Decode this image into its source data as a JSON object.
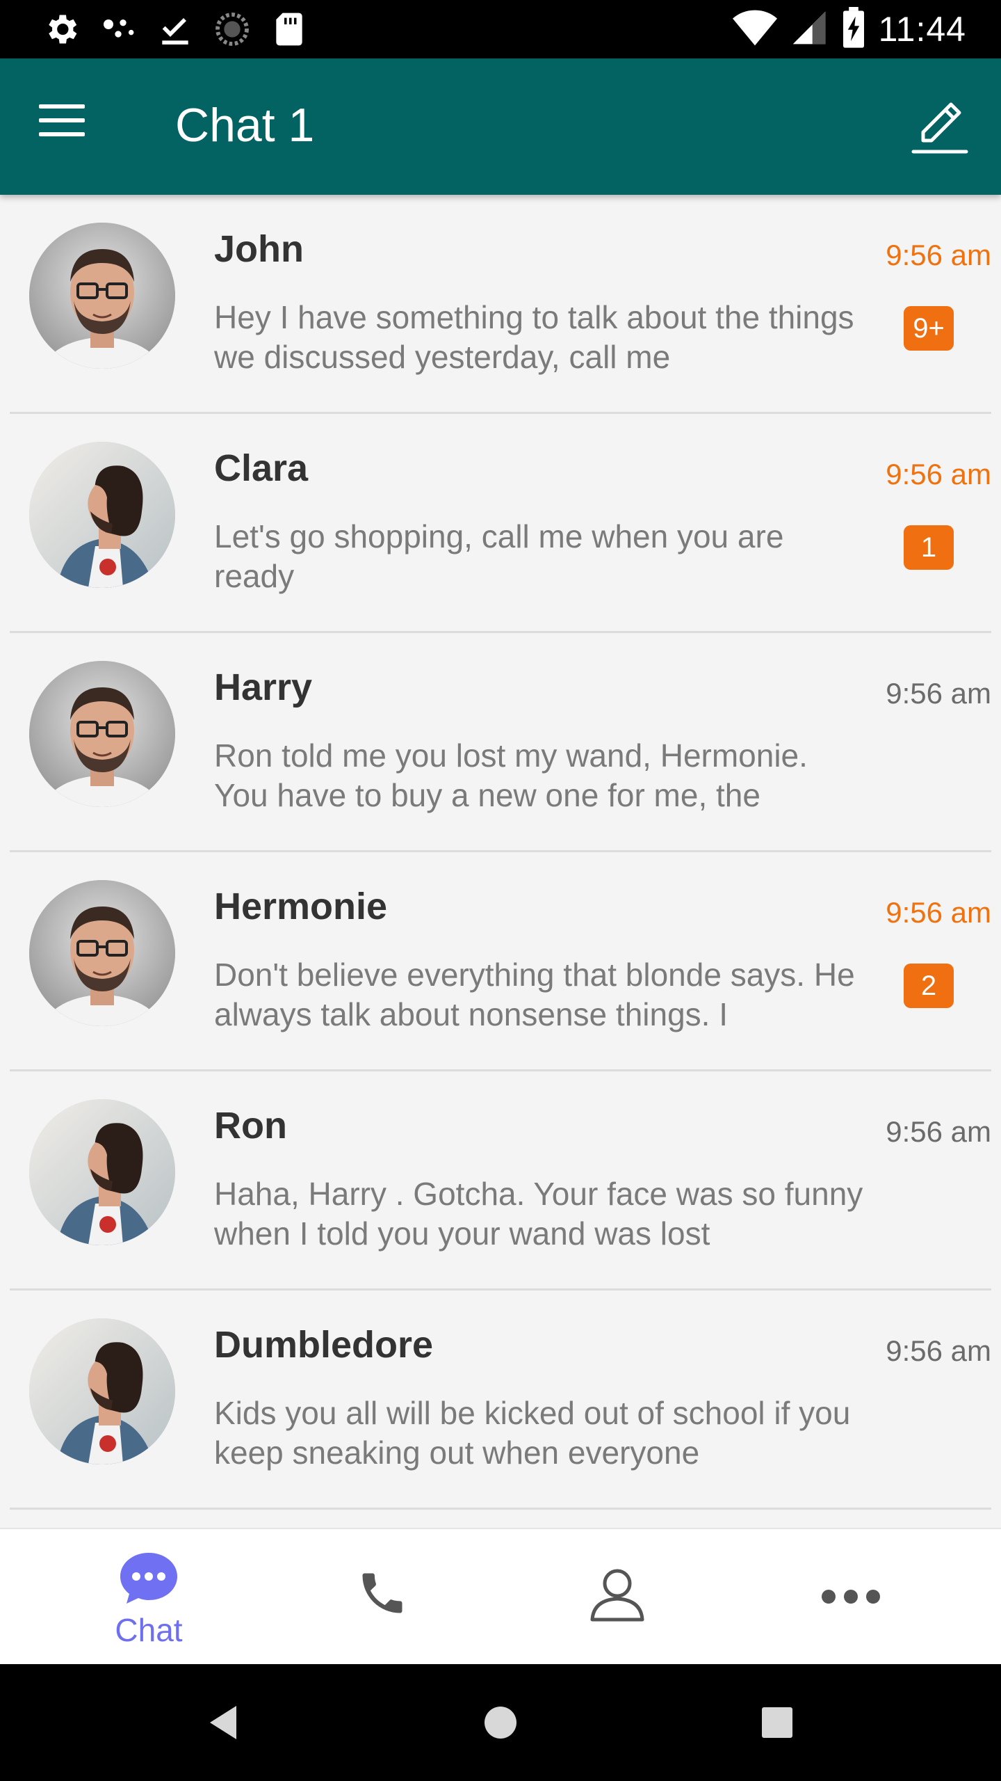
{
  "status_bar": {
    "time": "11:44",
    "left_icons": [
      "settings-icon",
      "dots-icon",
      "download-done-icon",
      "sync-icon",
      "sd-card-icon"
    ],
    "right_icons": [
      "wifi-icon",
      "signal-icon",
      "battery-charging-icon"
    ]
  },
  "app_bar": {
    "title": "Chat 1",
    "menu_icon": "hamburger-menu-icon",
    "action_icon": "edit-pencil-icon",
    "background": "#036262"
  },
  "colors": {
    "unread_time": "#f0720f",
    "badge": "#f06f10",
    "read_time": "#6b6b6b",
    "active_nav": "#6e6ef0"
  },
  "chats": [
    {
      "name": "John",
      "message": "Hey I have something to talk about the things we discussed yesterday, call me",
      "time": "9:56 am",
      "badge": "9+",
      "unread": true,
      "avatar": "glasses-man"
    },
    {
      "name": "Clara",
      "message": "Let's go shopping, call me when you are ready",
      "time": "9:56 am",
      "badge": "1",
      "unread": true,
      "avatar": "profile-man"
    },
    {
      "name": "Harry",
      "message": "Ron told me you lost my wand, Hermonie. You have to buy a new one for me, the",
      "time": "9:56 am",
      "badge": "",
      "unread": false,
      "avatar": "glasses-man"
    },
    {
      "name": "Hermonie",
      "message": "Don't believe everything that blonde says. He always talk about nonsense things. I",
      "time": "9:56 am",
      "badge": "2",
      "unread": true,
      "avatar": "glasses-man"
    },
    {
      "name": "Ron",
      "message": "Haha, Harry . Gotcha. Your face was so funny when I told you your wand was lost",
      "time": "9:56 am",
      "badge": "",
      "unread": false,
      "avatar": "profile-man"
    },
    {
      "name": "Dumbledore",
      "message": "Kids you all will be kicked out of school if you keep sneaking out when everyone",
      "time": "9:56 am",
      "badge": "",
      "unread": false,
      "avatar": "profile-man"
    }
  ],
  "bottom_nav": {
    "items": [
      {
        "label": "Chat",
        "icon": "chat-bubble-icon",
        "active": true
      },
      {
        "label": "",
        "icon": "phone-icon",
        "active": false
      },
      {
        "label": "",
        "icon": "person-icon",
        "active": false
      },
      {
        "label": "",
        "icon": "more-horizontal-icon",
        "active": false
      }
    ]
  },
  "system_nav": [
    "back-icon",
    "home-icon",
    "recents-icon"
  ]
}
